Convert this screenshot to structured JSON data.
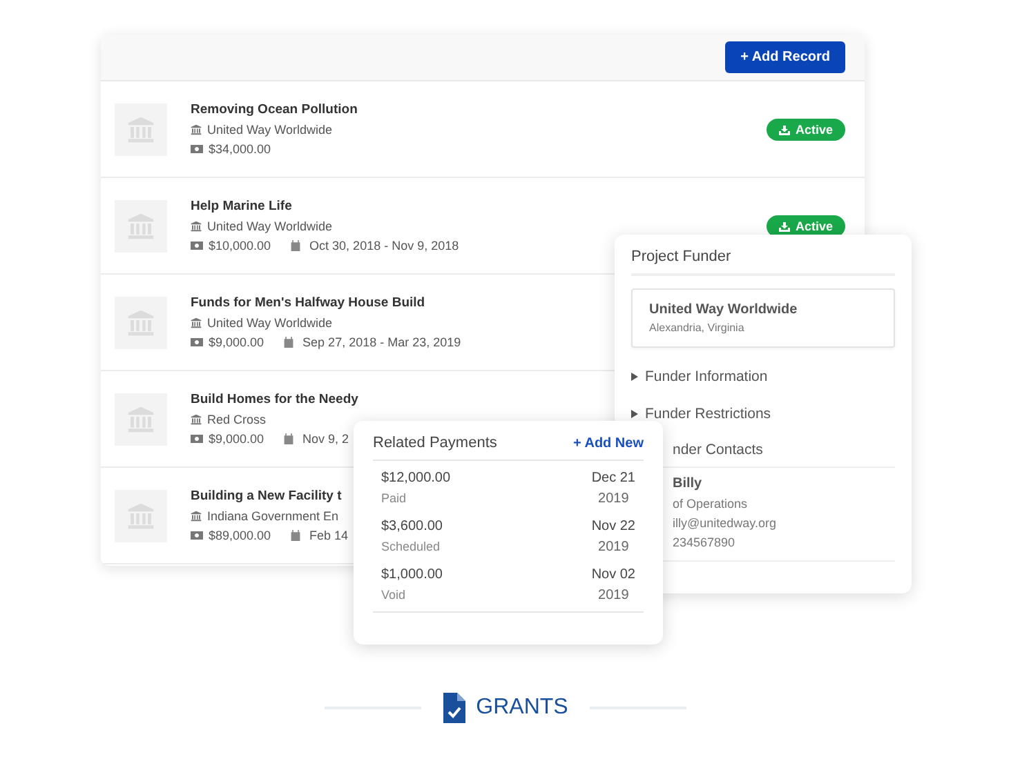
{
  "toolbar": {
    "add_button": "+ Add Record"
  },
  "records": [
    {
      "title": "Removing Ocean Pollution",
      "funder": "United Way Worldwide",
      "amount": "$34,000.00",
      "status": {
        "label": "Active",
        "kind": "active"
      }
    },
    {
      "title": "Help Marine Life",
      "funder": "United Way Worldwide",
      "amount": "$10,000.00",
      "dates": "Oct 30, 2018 - Nov 9, 2018",
      "status": {
        "label": "Active",
        "kind": "active"
      }
    },
    {
      "title": "Funds for Men's Halfway House Build",
      "funder": "United Way Worldwide",
      "amount": "$9,000.00",
      "dates": "Sep 27, 2018 - Mar 23, 2019"
    },
    {
      "title": "Build Homes for the Needy",
      "funder": "Red Cross",
      "amount": "$9,000.00",
      "dates": "Nov 9, 2"
    },
    {
      "title": "Building a New Facility t",
      "funder": "Indiana Government En",
      "amount": "$89,000.00",
      "dates": "Feb 14"
    }
  ],
  "project_funder": {
    "title": "Project Funder",
    "name": "United Way Worldwide",
    "location": "Alexandria, Virginia",
    "sections": [
      {
        "label": "Funder Information",
        "expanded": false
      },
      {
        "label": "Funder Restrictions",
        "expanded": false
      }
    ],
    "contacts": {
      "title": "nder Contacts",
      "name": "Billy",
      "role": "of Operations",
      "email": "illy@unitedway.org",
      "phone": "234567890"
    }
  },
  "related_payments": {
    "title": "Related Payments",
    "add_link": "+ Add New",
    "payments": [
      {
        "amount": "$12,000.00",
        "status": "Paid",
        "date": "Dec 21",
        "year": "2019"
      },
      {
        "amount": "$3,600.00",
        "status": "Scheduled",
        "date": "Nov 22",
        "year": "2019"
      },
      {
        "amount": "$1,000.00",
        "status": "Void",
        "date": "Nov 02",
        "year": "2019"
      }
    ]
  },
  "footer": {
    "label": "GRANTS"
  }
}
